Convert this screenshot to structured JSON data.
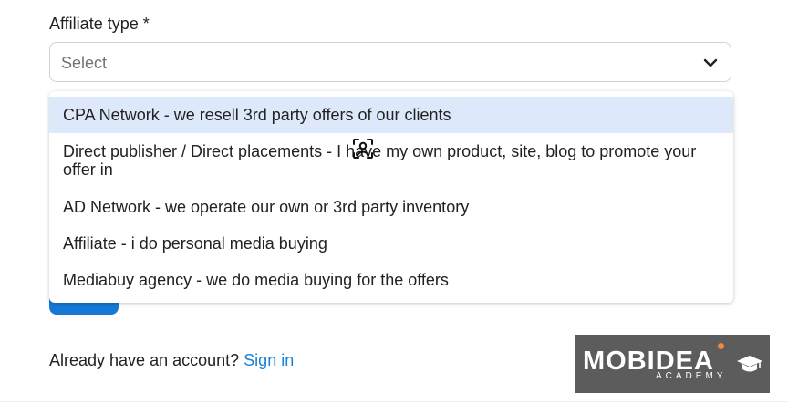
{
  "form": {
    "affiliate_type_label": "Affiliate type *",
    "select_placeholder": "Select"
  },
  "dropdown": {
    "options": [
      "CPA Network - we resell 3rd party offers of our clients",
      "Direct publisher / Direct placements - I have my own product, site, blog to promote your offer in",
      "AD Network - we operate our own or 3rd party inventory",
      "Affiliate - i do personal media buying",
      "Mediabuy agency - we do media buying for the offers"
    ],
    "highlighted_index": 0
  },
  "signin": {
    "prompt": "Already have an account?",
    "link_label": "Sign in"
  },
  "logo": {
    "word": "MOBIDEA",
    "sub": "ACADEMY"
  },
  "icons": {
    "chevron": "chevron-down-icon",
    "cursor": "cursor-grab-icon",
    "cap": "graduation-cap-icon"
  },
  "colors": {
    "accent": "#1478d4",
    "link": "#1a82d6",
    "highlight": "#dde9fb",
    "logo_bg": "#5c5c5c",
    "logo_dot": "#f08a3c"
  }
}
